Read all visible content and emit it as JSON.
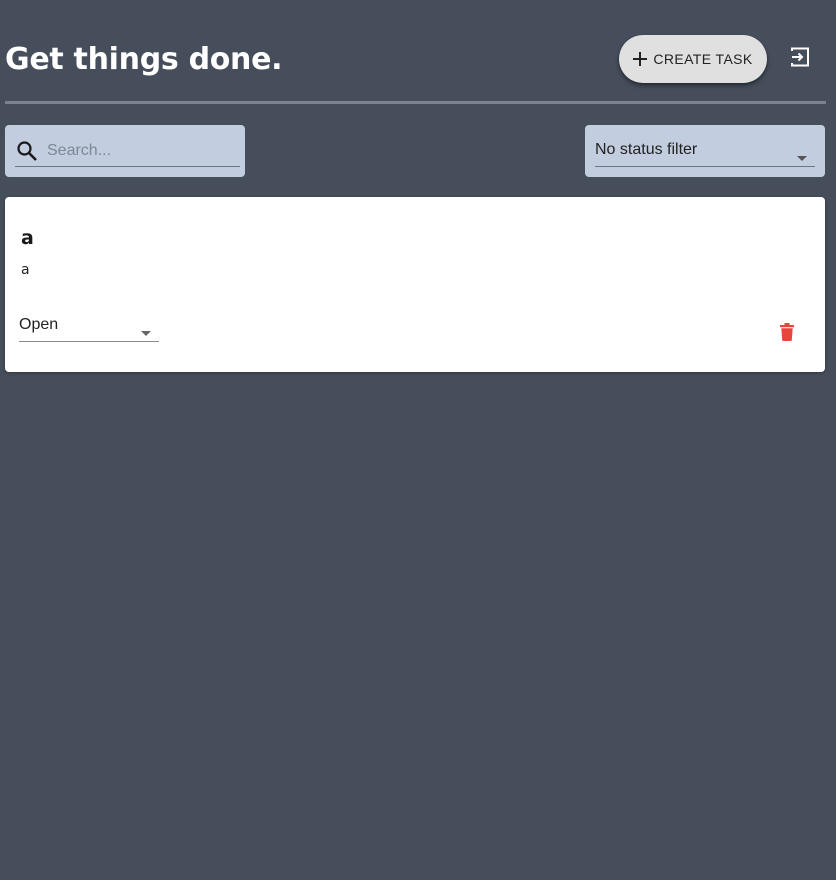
{
  "header": {
    "title": "Get things done.",
    "create_task_label": "CREATE TASK",
    "create_icon": "plus-icon",
    "logout_icon": "logout-icon"
  },
  "filters": {
    "search": {
      "placeholder": "Search...",
      "value": "",
      "icon": "search-icon"
    },
    "status_filter": {
      "selected": "No status filter"
    }
  },
  "tasks": [
    {
      "title": "a",
      "description": "a",
      "status": "Open",
      "delete_icon": "trash-icon"
    }
  ],
  "colors": {
    "background": "#464e5c",
    "input_background": "#c3cde0",
    "card_background": "#ffffff",
    "button_background": "#e0e0e0",
    "delete_red": "#e8453c"
  }
}
